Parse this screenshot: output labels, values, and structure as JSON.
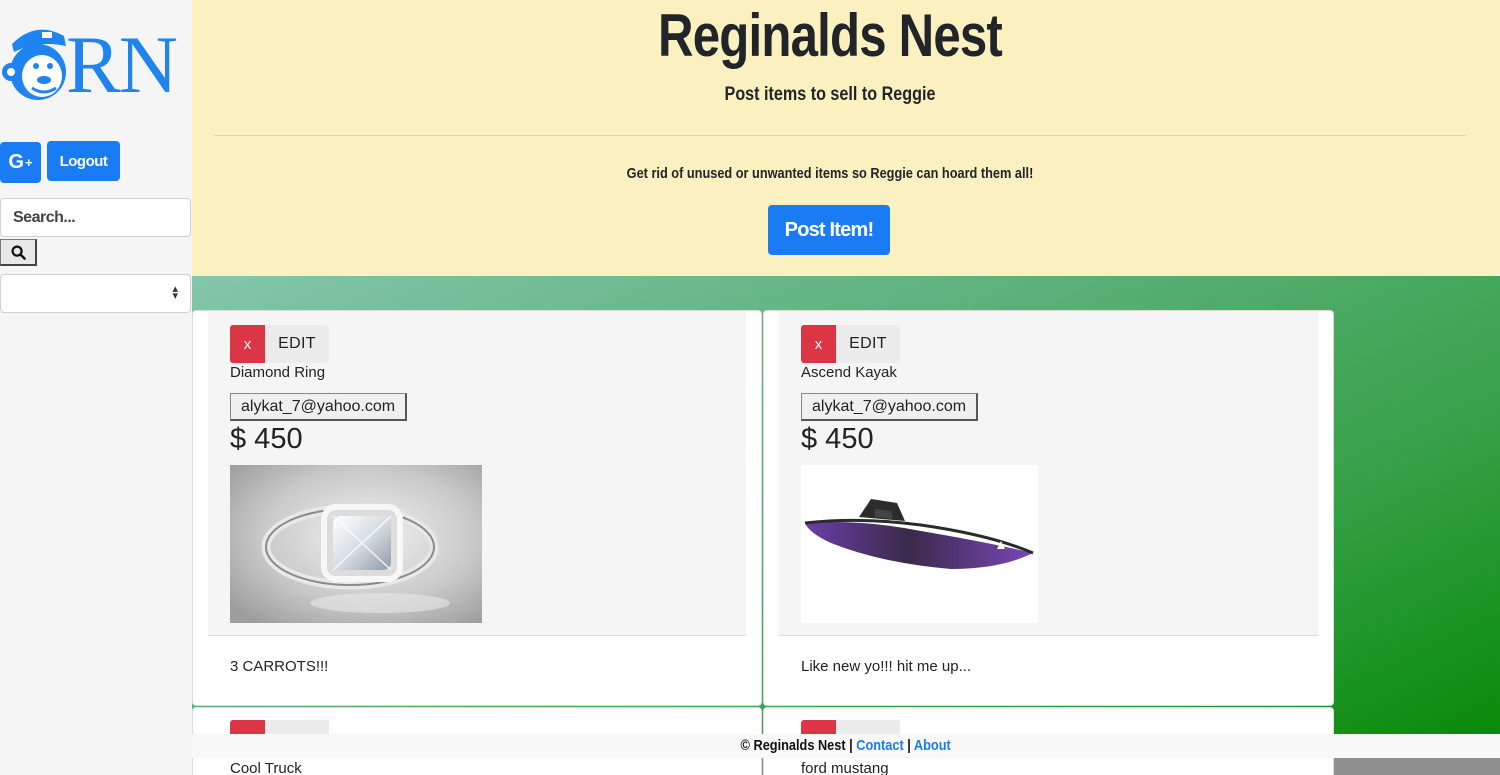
{
  "sidebar": {
    "logo_text": "RN",
    "gplus_label": "G",
    "gplus_sup": "+",
    "logout_label": "Logout",
    "search_placeholder": "Search...",
    "select_value": ""
  },
  "hero": {
    "title": "Reginalds Nest",
    "subtitle": "Post items to sell to Reggie",
    "lead": "Get rid of unused or unwanted items so Reggie can hoard them all!",
    "post_button": "Post Item!"
  },
  "items": [
    {
      "delete_label": "x",
      "edit_label": "EDIT",
      "title": "Diamond Ring",
      "email": "alykat_7@yahoo.com",
      "price": "$ 450",
      "description": "3 CARROTS!!!"
    },
    {
      "delete_label": "x",
      "edit_label": "EDIT",
      "title": "Ascend Kayak",
      "email": "alykat_7@yahoo.com",
      "price": "$ 450",
      "description": "Like new yo!!! hit me up..."
    },
    {
      "title": "Cool Truck"
    },
    {
      "title": "ford mustang"
    }
  ],
  "footer": {
    "copyright": "© Reginalds Nest",
    "sep1": "|",
    "contact": "Contact",
    "sep2": "|",
    "about": "About"
  },
  "colors": {
    "primary": "#1a7cf5",
    "danger": "#dc3545",
    "hero_bg": "#fbf0bf"
  }
}
